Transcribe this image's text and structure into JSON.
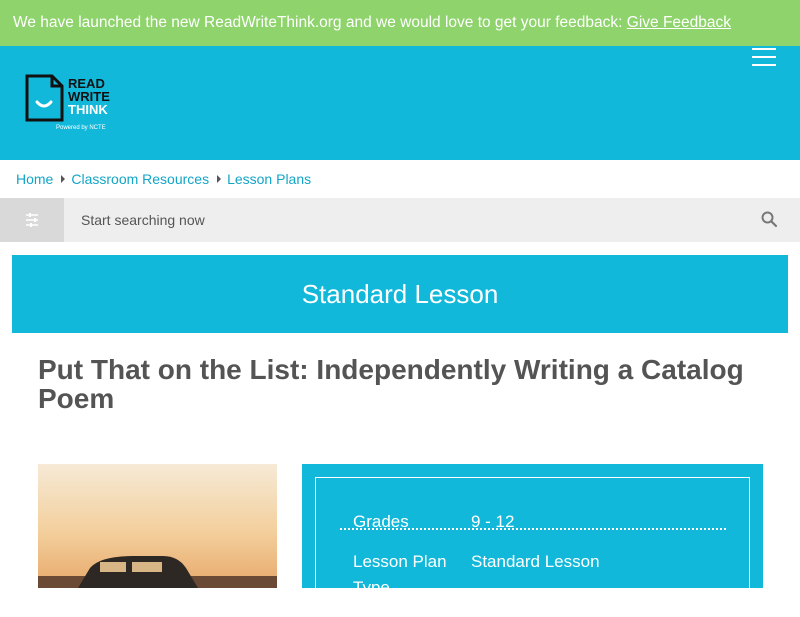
{
  "banner": {
    "text": "We have launched the new ReadWriteThink.org and we would love to get your feedback:",
    "link": "Give Feedback"
  },
  "header": {
    "logo": {
      "line1": "READ",
      "line2": "WRITE",
      "line3": "THINK",
      "tagline": "Powered by NCTE"
    }
  },
  "breadcrumb": {
    "items": [
      "Home",
      "Classroom Resources",
      "Lesson Plans"
    ]
  },
  "search": {
    "placeholder": "Start searching now"
  },
  "lesson_type_banner": "Standard Lesson",
  "page_title": "Put That on the List: Independently Writing a Catalog Poem",
  "info": {
    "rows": [
      {
        "label": "Grades",
        "value": "9 - 12"
      },
      {
        "label": "Lesson Plan Type",
        "value": "Standard Lesson"
      }
    ]
  },
  "colors": {
    "banner": "#8ed36b",
    "brand": "#12b8d9",
    "link": "#12a5c8",
    "title": "#545454"
  }
}
